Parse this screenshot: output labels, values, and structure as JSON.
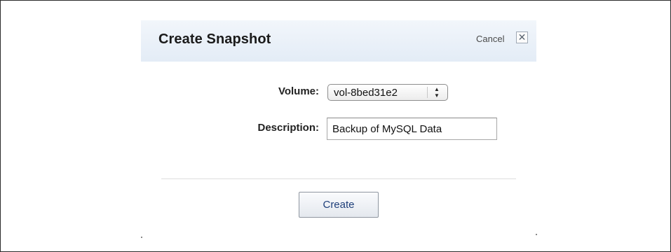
{
  "dialog": {
    "title": "Create Snapshot",
    "cancel_label": "Cancel",
    "close_glyph": "✕",
    "volume_label": "Volume:",
    "volume_value": "vol-8bed31e2",
    "volume_arrows": "▲\n▼",
    "description_label": "Description:",
    "description_value": "Backup of MySQL Data",
    "create_label": "Create"
  },
  "colors": {
    "header_top": "#f2f6fb",
    "header_bottom": "#e3ecf6",
    "create_text": "#1e3f7a"
  },
  "icons": {
    "close": "close-icon",
    "select_arrows": "chevron-up-down-icon"
  }
}
